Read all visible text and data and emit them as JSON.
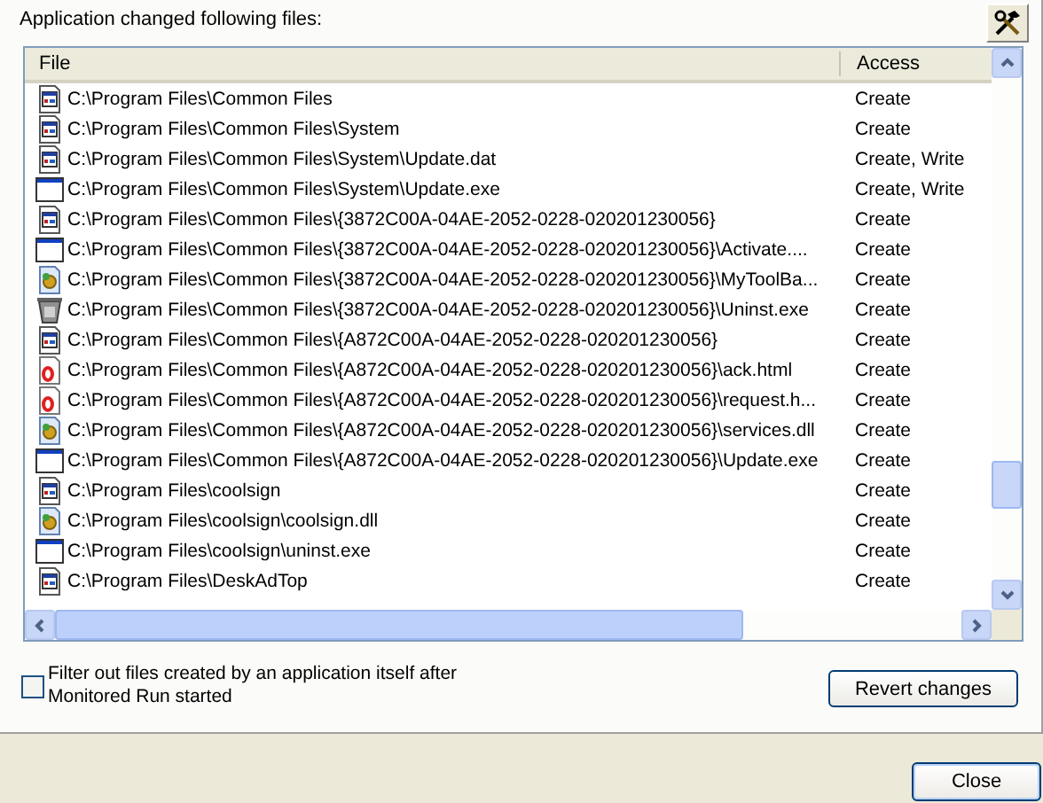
{
  "heading": "Application changed following files:",
  "table": {
    "columns": [
      "File",
      "Access"
    ],
    "rows": [
      {
        "kind": "file",
        "path": "C:\\Program Files\\Common Files",
        "access": "Create"
      },
      {
        "kind": "file",
        "path": "C:\\Program Files\\Common Files\\System",
        "access": "Create"
      },
      {
        "kind": "file",
        "path": "C:\\Program Files\\Common Files\\System\\Update.dat",
        "access": "Create, Write"
      },
      {
        "kind": "exe",
        "path": "C:\\Program Files\\Common Files\\System\\Update.exe",
        "access": "Create, Write"
      },
      {
        "kind": "file",
        "path": "C:\\Program Files\\Common Files\\{3872C00A-04AE-2052-0228-020201230056}",
        "access": "Create"
      },
      {
        "kind": "exe",
        "path": "C:\\Program Files\\Common Files\\{3872C00A-04AE-2052-0228-020201230056}\\Activate....",
        "access": "Create"
      },
      {
        "kind": "dll",
        "path": "C:\\Program Files\\Common Files\\{3872C00A-04AE-2052-0228-020201230056}\\MyToolBa...",
        "access": "Create"
      },
      {
        "kind": "uninstaller",
        "path": "C:\\Program Files\\Common Files\\{3872C00A-04AE-2052-0228-020201230056}\\Uninst.exe",
        "access": "Create"
      },
      {
        "kind": "file",
        "path": "C:\\Program Files\\Common Files\\{A872C00A-04AE-2052-0228-020201230056}",
        "access": "Create"
      },
      {
        "kind": "html",
        "path": "C:\\Program Files\\Common Files\\{A872C00A-04AE-2052-0228-020201230056}\\ack.html",
        "access": "Create"
      },
      {
        "kind": "html",
        "path": "C:\\Program Files\\Common Files\\{A872C00A-04AE-2052-0228-020201230056}\\request.h...",
        "access": "Create"
      },
      {
        "kind": "dll",
        "path": "C:\\Program Files\\Common Files\\{A872C00A-04AE-2052-0228-020201230056}\\services.dll",
        "access": "Create"
      },
      {
        "kind": "exe",
        "path": "C:\\Program Files\\Common Files\\{A872C00A-04AE-2052-0228-020201230056}\\Update.exe",
        "access": "Create"
      },
      {
        "kind": "file",
        "path": "C:\\Program Files\\coolsign",
        "access": "Create"
      },
      {
        "kind": "dll",
        "path": "C:\\Program Files\\coolsign\\coolsign.dll",
        "access": "Create"
      },
      {
        "kind": "exe",
        "path": "C:\\Program Files\\coolsign\\uninst.exe",
        "access": "Create"
      },
      {
        "kind": "file",
        "path": "C:\\Program Files\\DeskAdTop",
        "access": "Create"
      }
    ]
  },
  "filter": {
    "label": "Filter out files created by an application itself after Monitored Run started",
    "checked": false
  },
  "buttons": {
    "revert": "Revert changes",
    "close": "Close"
  }
}
